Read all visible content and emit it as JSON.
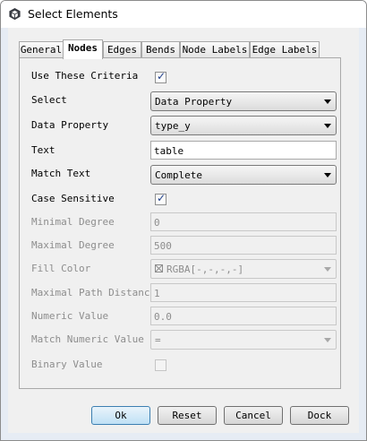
{
  "window": {
    "title": "Select Elements",
    "icon": "app-cube-icon"
  },
  "tabs": [
    {
      "label": "General",
      "active": false
    },
    {
      "label": "Nodes",
      "active": true
    },
    {
      "label": "Edges",
      "active": false
    },
    {
      "label": "Bends",
      "active": false
    },
    {
      "label": "Node Labels",
      "active": false
    },
    {
      "label": "Edge Labels",
      "active": false
    }
  ],
  "form": {
    "use_criteria": {
      "label": "Use These Criteria",
      "checked": true
    },
    "select": {
      "label": "Select",
      "value": "Data Property"
    },
    "data_property": {
      "label": "Data Property",
      "value": "type_y"
    },
    "text": {
      "label": "Text",
      "value": "table"
    },
    "match_text": {
      "label": "Match Text",
      "value": "Complete"
    },
    "case_sensitive": {
      "label": "Case Sensitive",
      "checked": true
    },
    "minimal_degree": {
      "label": "Minimal Degree",
      "value": "0",
      "enabled": false
    },
    "maximal_degree": {
      "label": "Maximal Degree",
      "value": "500",
      "enabled": false
    },
    "fill_color": {
      "label": "Fill Color",
      "value": "RGBA[-,-,-,-]",
      "enabled": false
    },
    "maximal_path_distance": {
      "label": "Maximal Path Distance",
      "value": "1",
      "enabled": false
    },
    "numeric_value": {
      "label": "Numeric Value",
      "value": "0.0",
      "enabled": false
    },
    "match_numeric_value": {
      "label": "Match Numeric Value",
      "value": "=",
      "enabled": false
    },
    "binary_value": {
      "label": "Binary Value",
      "checked": false,
      "enabled": false
    }
  },
  "buttons": {
    "ok": "Ok",
    "reset": "Reset",
    "cancel": "Cancel",
    "dock": "Dock"
  },
  "colors": {
    "checkmark": "#1e3e8a",
    "default_button": "#bfe0f5",
    "disabled_text": "#8d8d8d"
  }
}
